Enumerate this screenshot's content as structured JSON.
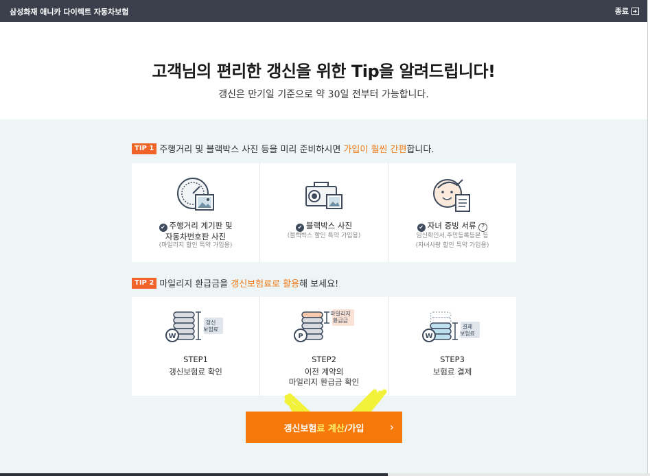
{
  "window": {
    "title": "삼성화재 애니카 다이렉트 자동차보험",
    "close_label": "종료"
  },
  "hero": {
    "title": "고객님의 편리한 갱신을 위한 Tip을 알려드립니다!",
    "subtitle": "갱신은 만기일 기준으로 약 30일 전부터 가능합니다."
  },
  "tip1": {
    "badge": "TIP 1",
    "text_before": "주행거리 및 블랙박스 사진 등을 미리 준비하시면 ",
    "text_highlight": "가입이 훨씬 간편",
    "text_after": "합니다.",
    "cards": [
      {
        "title_line1": "주행거리 계기판 및",
        "title_line2": "자동차번호판 사진",
        "sub_line1": "(마일리지 할인 특약 가입용)",
        "sub_line2": "",
        "icon": "odometer-photo-icon"
      },
      {
        "title_line1": "블랙박스 사진",
        "title_line2": "",
        "sub_line1": "(블랙박스 할인 특약 가입용)",
        "sub_line2": "",
        "icon": "dashcam-photo-icon"
      },
      {
        "title_line1": "자녀 증빙 서류",
        "title_line2": "",
        "sub_line1": "임신확인서,주민등록등본 등",
        "sub_line2": "(자녀사랑 할인 특약 가입용)",
        "icon": "child-document-icon"
      }
    ]
  },
  "tip2": {
    "badge": "TIP 2",
    "text_before": "마일리지 환급금을 ",
    "text_highlight": "갱신보험료로 활용",
    "text_after": "해 보세요!",
    "steps": [
      {
        "label": "STEP1",
        "desc_line1": "갱신보험료 확인",
        "desc_line2": "",
        "tag_line1": "갱신",
        "tag_line2": "보험료",
        "icon": "coin-stack-w-icon"
      },
      {
        "label": "STEP2",
        "desc_line1": "이전 계약의",
        "desc_line2": "마일리지 환급금 확인",
        "tag_line1": "마일리지",
        "tag_line2": "환급금",
        "icon": "coin-stack-p-icon"
      },
      {
        "label": "STEP3",
        "desc_line1": "보험료 결제",
        "desc_line2": "",
        "tag_line1": "결제",
        "tag_line2": "보험료",
        "icon": "coin-stack-pay-icon"
      }
    ]
  },
  "cta": {
    "label_part1": "갱신보험",
    "label_part2": "료 계산",
    "label_part3": "/가입",
    "arrow": "›"
  },
  "colors": {
    "accent_orange": "#f57a0b",
    "tip_badge": "#f0642a",
    "titlebar": "#3b3f4c",
    "content_bg": "#eef5f7"
  }
}
